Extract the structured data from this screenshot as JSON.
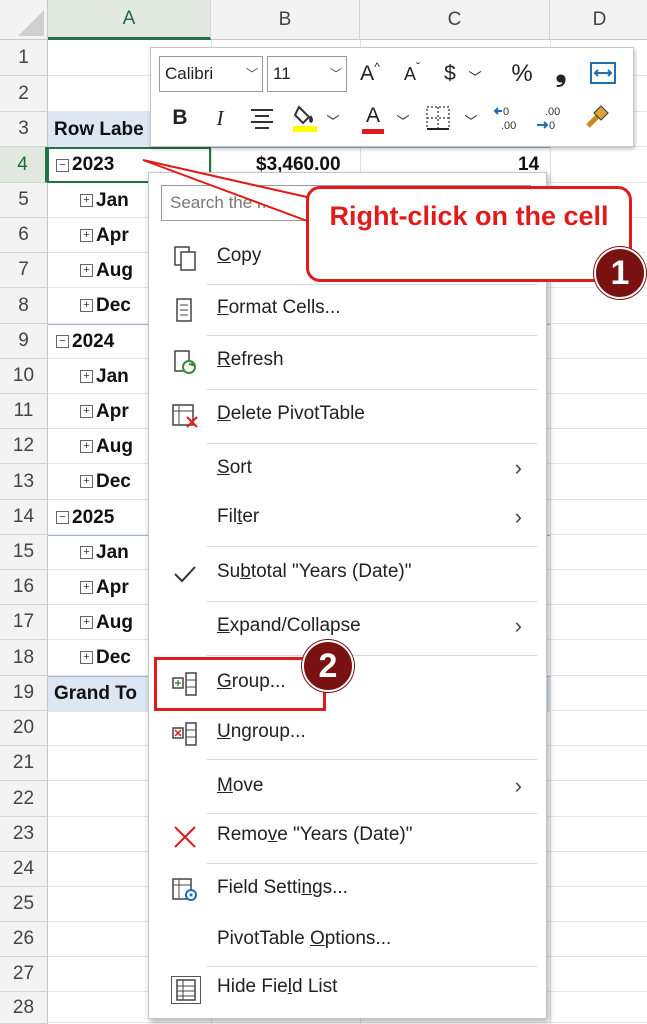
{
  "columns": [
    "A",
    "B",
    "C",
    "D"
  ],
  "rows": [
    "1",
    "2",
    "3",
    "4",
    "5",
    "6",
    "7",
    "8",
    "9",
    "10",
    "11",
    "12",
    "13",
    "14",
    "15",
    "16",
    "17",
    "18",
    "19",
    "20",
    "21",
    "22",
    "23",
    "24",
    "25",
    "26",
    "27",
    "28"
  ],
  "cells": {
    "a3": "Row Labe",
    "a4": "2023",
    "b4": "$3,460.00",
    "c4": "14",
    "a5": "Jan",
    "a6": "Apr",
    "a7": "Aug",
    "a8": "Dec",
    "a9": "2024",
    "a10": "Jan",
    "a11": "Apr",
    "a12": "Aug",
    "a13": "Dec",
    "a14": "2025",
    "a15": "Jan",
    "a16": "Apr",
    "a17": "Aug",
    "a18": "Dec",
    "a19": "Grand To"
  },
  "mini_toolbar": {
    "font_name": "Calibri",
    "font_size": "11",
    "bold": "B",
    "italic": "I",
    "font_color_letter": "A",
    "currency": "$",
    "percent": "%",
    "comma": "❟"
  },
  "menu": {
    "search_placeholder": "Search the me",
    "items": [
      {
        "label_pre": "",
        "label_u": "C",
        "label_post": "opy"
      },
      {
        "label_pre": "",
        "label_u": "F",
        "label_post": "ormat Cells..."
      },
      {
        "label_pre": "",
        "label_u": "R",
        "label_post": "efresh"
      },
      {
        "label_pre": "",
        "label_u": "D",
        "label_post": "elete PivotTable"
      },
      {
        "label_pre": "",
        "label_u": "S",
        "label_post": "ort"
      },
      {
        "label_pre": "Fil",
        "label_u": "t",
        "label_post": "er"
      },
      {
        "label_pre": "Su",
        "label_u": "b",
        "label_post": "total \"Years (Date)\""
      },
      {
        "label_pre": "",
        "label_u": "E",
        "label_post": "xpand/Collapse"
      },
      {
        "label_pre": "",
        "label_u": "G",
        "label_post": "roup..."
      },
      {
        "label_pre": "",
        "label_u": "U",
        "label_post": "ngroup..."
      },
      {
        "label_pre": "",
        "label_u": "M",
        "label_post": "ove"
      },
      {
        "label_pre": "Remo",
        "label_u": "v",
        "label_post": "e \"Years (Date)\""
      },
      {
        "label_pre": "Field Setti",
        "label_u": "n",
        "label_post": "gs..."
      },
      {
        "label_pre": "PivotTable ",
        "label_u": "O",
        "label_post": "ptions..."
      },
      {
        "label_pre": "Hide Fie",
        "label_u": "l",
        "label_post": "d List"
      }
    ]
  },
  "annotations": {
    "callout_text": "Right-click on the cell",
    "step1": "1",
    "step2": "2",
    "accent_color": "#e01b1b",
    "badge_color": "#7a1212"
  }
}
